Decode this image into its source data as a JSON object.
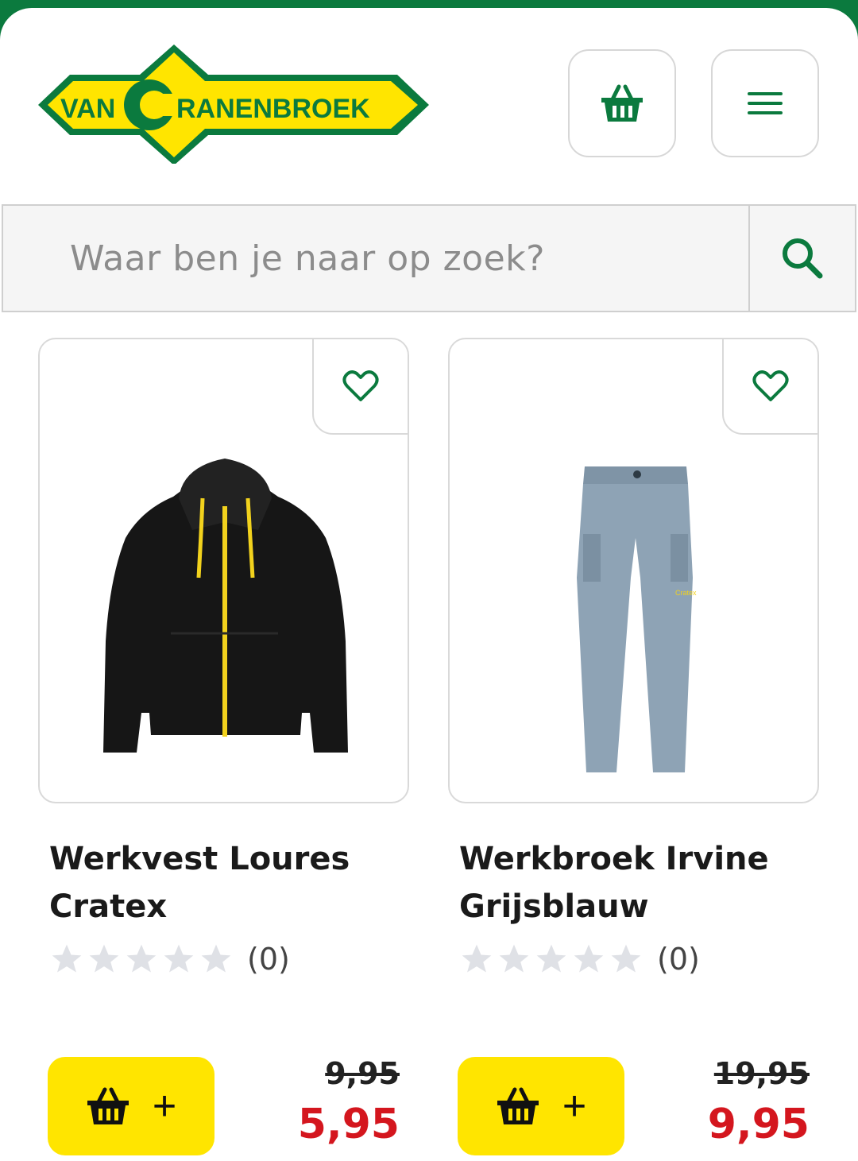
{
  "header": {
    "logo_text_left": "VAN",
    "logo_text_c": "C",
    "logo_text_right": "RANENBROEK",
    "icons": {
      "cart": "basket-icon",
      "menu": "hamburger-menu-icon"
    }
  },
  "search": {
    "placeholder": "Waar ben je naar op zoek?",
    "button_icon": "search-icon"
  },
  "colors": {
    "brand_green": "#0b7a3e",
    "brand_yellow": "#ffe500",
    "sale_red": "#d4161e"
  },
  "products": [
    {
      "title": "Werkvest Loures Cratex",
      "rating_count": "(0)",
      "stars": 0,
      "old_price": "9,95",
      "new_price": "5,95",
      "add_label": "+"
    },
    {
      "title": "Werkbroek Irvine Grijsblauw",
      "rating_count": "(0)",
      "stars": 0,
      "old_price": "19,95",
      "new_price": "9,95",
      "add_label": "+"
    }
  ]
}
